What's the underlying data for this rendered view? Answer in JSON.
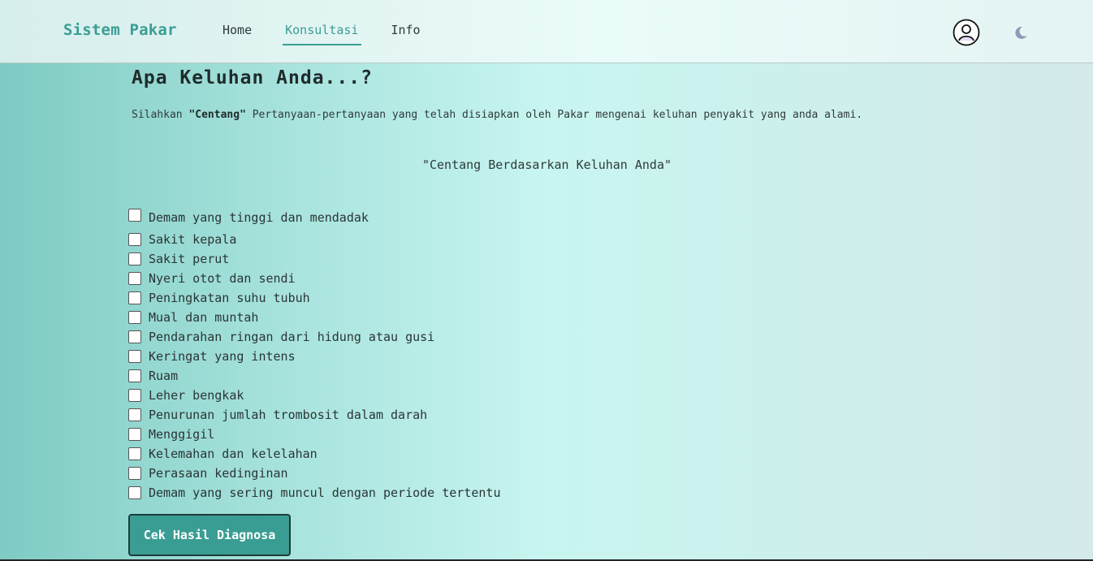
{
  "nav": {
    "brand": "Sistem Pakar",
    "links": [
      {
        "label": "Home",
        "active": false
      },
      {
        "label": "Konsultasi",
        "active": true
      },
      {
        "label": "Info",
        "active": false
      }
    ],
    "avatar_icon": "user-circle-icon",
    "theme_icon": "moon-icon"
  },
  "main": {
    "heading": "Apa Keluhan Anda...?",
    "intro_prefix": "Silahkan ",
    "intro_bold": "\"Centang\"",
    "intro_suffix": " Pertanyaan-pertanyaan yang telah disiapkan oleh Pakar mengenai keluhan penyakit yang anda alami.",
    "subheading": "\"Centang Berdasarkan Keluhan Anda\"",
    "symptoms": [
      "Demam yang tinggi dan mendadak",
      "Sakit kepala",
      "Sakit perut",
      "Nyeri otot dan sendi",
      "Peningkatan suhu tubuh",
      "Mual dan muntah",
      "Pendarahan ringan dari hidung atau gusi",
      "Keringat yang intens",
      "Ruam",
      "Leher bengkak",
      "Penurunan jumlah trombosit dalam darah",
      "Menggigil",
      "Kelemahan dan kelelahan",
      "Perasaan kedinginan",
      "Demam yang sering muncul dengan periode tertentu"
    ],
    "submit_label": "Cek Hasil Diagnosa"
  },
  "colors": {
    "accent": "#3a9d93",
    "text": "#2f3b3b"
  }
}
